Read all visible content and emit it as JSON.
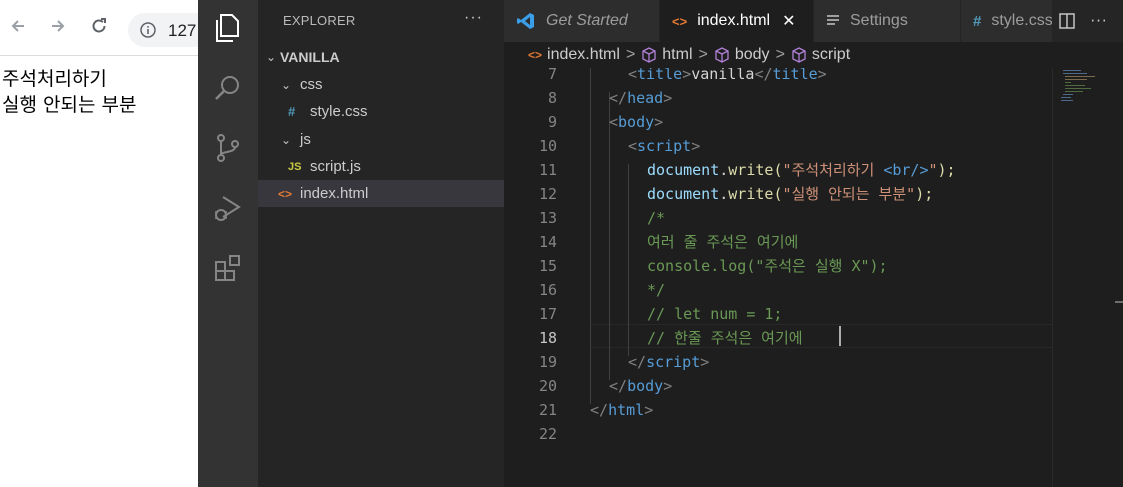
{
  "browser": {
    "url": "127",
    "content_lines": [
      "주석처리하기",
      "실행 안되는 부분"
    ]
  },
  "activity_bar": {
    "items": [
      "explorer-icon",
      "search-icon",
      "source-control-icon",
      "run-debug-icon",
      "extensions-icon"
    ]
  },
  "sidebar": {
    "title": "EXPLORER",
    "more": "···",
    "tree": [
      {
        "label": "VANILLA",
        "icon": "",
        "chevron": "⌄",
        "kind": "root"
      },
      {
        "label": "css",
        "icon": "",
        "chevron": "⌄",
        "kind": "folder"
      },
      {
        "label": "style.css",
        "icon": "#",
        "chevron": "",
        "kind": "file"
      },
      {
        "label": "js",
        "icon": "",
        "chevron": "⌄",
        "kind": "folder"
      },
      {
        "label": "script.js",
        "icon": "JS",
        "chevron": "",
        "kind": "file"
      },
      {
        "label": "index.html",
        "icon": "<>",
        "chevron": "",
        "kind": "file"
      }
    ]
  },
  "tabs": [
    {
      "label": "Get Started",
      "icon": "vscode-icon"
    },
    {
      "label": "index.html",
      "icon": "html-icon",
      "close": "✕"
    },
    {
      "label": "Settings",
      "icon": "settings-icon"
    },
    {
      "label": "style.css",
      "icon": "css-icon"
    }
  ],
  "breadcrumb": {
    "items": [
      "index.html",
      "html",
      "body",
      "script"
    ],
    "separator": ">"
  },
  "editor": {
    "line_numbers": [
      "7",
      "8",
      "9",
      "10",
      "11",
      "12",
      "13",
      "14",
      "15",
      "16",
      "17",
      "18",
      "19",
      "20",
      "21",
      "22"
    ],
    "current_line": "18",
    "code": {
      "l7": [
        "<",
        "title",
        ">",
        "vanilla",
        "</",
        "title",
        ">"
      ],
      "l8": [
        "</",
        "head",
        ">"
      ],
      "l9": [
        "<",
        "body",
        ">"
      ],
      "l10": [
        "<",
        "script",
        ">"
      ],
      "l11": [
        "document",
        ".",
        "write",
        "(",
        "\"주석처리하기 ",
        "<br/>",
        "\"",
        ");"
      ],
      "l12": [
        "document",
        ".",
        "write",
        "(",
        "\"실행 안되는 부분\"",
        ");"
      ],
      "l13": [
        "/*"
      ],
      "l14": [
        "여러 줄 주석은 여기에"
      ],
      "l15": [
        "console.log(\"주석은 실행 X\");"
      ],
      "l16": [
        "*/"
      ],
      "l17": [
        "// let num = 1;"
      ],
      "l18": [
        "// 한줄 주석은 여기에"
      ],
      "l19": [
        "</",
        "script",
        ">"
      ],
      "l20": [
        "</",
        "body",
        ">"
      ],
      "l21": [
        "</",
        "html",
        ">"
      ],
      "l22": [
        ""
      ]
    }
  },
  "colors": {
    "editor_bg": "#1e1e1e",
    "sidebar_bg": "#252526",
    "activity_bg": "#333333",
    "tag_blue": "#569cd6",
    "string_orange": "#ce9178",
    "comment_green": "#6a9955",
    "function_yellow": "#dcdcaa",
    "identifier_blue": "#9cdcfe"
  }
}
